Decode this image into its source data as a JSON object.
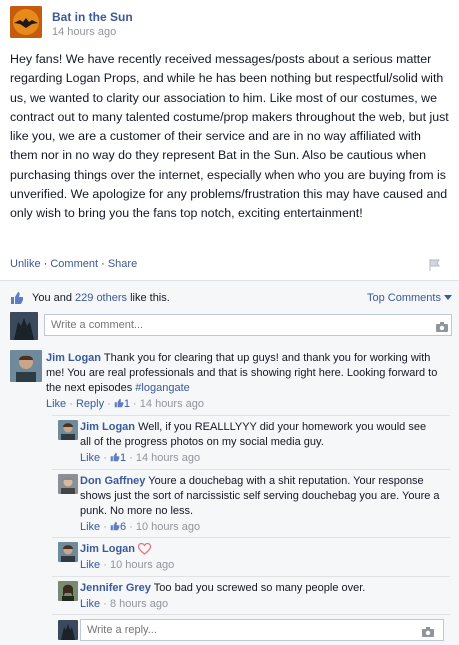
{
  "post": {
    "page_name": "Bat in the Sun",
    "time": "14 hours ago",
    "text": "Hey fans! We have recently received messages/posts about a serious matter regarding Logan Props, and while he has been nothing but respectful/solid with us, we wanted to clarity our association to him. Like most of our costumes, we contract out to many talented costume/prop makers throughout the web, but just like you, we are a customer of their service and are in no way affiliated with them nor in no way do they represent Bat in the Sun. Also be cautious when purchasing things over the internet, especially when who you are buying from is unverified. We apologize for any problems/frustration this may have caused and only wish to bring you the fans top notch, exciting entertainment!"
  },
  "actions": {
    "unlike": "Unlike",
    "comment": "Comment",
    "share": "Share",
    "sep": " · "
  },
  "likes": {
    "prefix": "You and ",
    "count": "229 others",
    "suffix": " like this.",
    "top_comments": "Top Comments"
  },
  "write_comment": {
    "placeholder": "Write a comment..."
  },
  "comments": [
    {
      "author": "Jim Logan",
      "text": "Thank you for clearing that up guys! and thank you for working with me! You are real professionals and that is showing right here. Looking forward to the next episodes ",
      "tag": "#logangate",
      "like": "Like",
      "reply": "Reply",
      "likes": "1",
      "time": "14 hours ago"
    }
  ],
  "replies": [
    {
      "author": "Jim Logan",
      "text": "Well, if you REALLLYYY did your homework you would see all of the progress photos on my social media guy.",
      "like": "Like",
      "likes": "1",
      "time": "14 hours ago"
    },
    {
      "author": "Don Gaffney",
      "text": "Youre a douchebag with a shit reputation. Your response shows just the sort of narcissistic self serving douchebag you are. Youre a punk. No more no less.",
      "like": "Like",
      "likes": "6",
      "time": "10 hours ago"
    },
    {
      "author": "Jim Logan",
      "text": "",
      "like": "Like",
      "time": "10 hours ago"
    },
    {
      "author": "Jennifer Grey",
      "text": "Too bad you screwed so many people over.",
      "like": "Like",
      "time": "8 hours ago"
    }
  ],
  "write_reply": {
    "placeholder": "Write a reply..."
  },
  "colors": {
    "link": "#3b5998",
    "meta": "#90949c",
    "panel": "#f6f7f9",
    "heart": "#f06b7a"
  },
  "icons": [
    "page-logo-icon",
    "flag-icon",
    "like-thumb-icon",
    "camera-icon",
    "heart-icon",
    "chevron-down-icon"
  ]
}
